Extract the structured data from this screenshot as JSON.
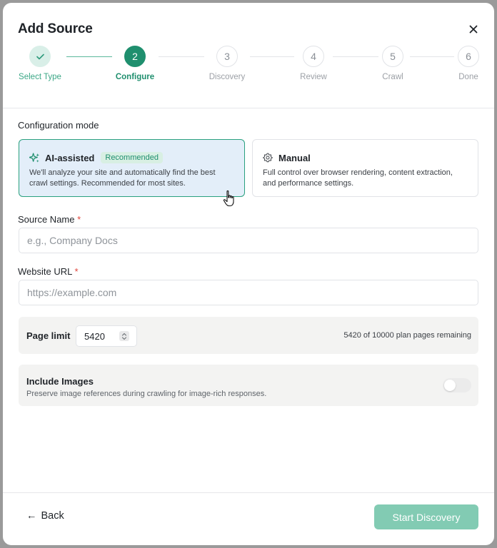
{
  "dialog": {
    "title": "Add Source"
  },
  "steps": [
    {
      "number": "",
      "label": "Select Type",
      "state": "done"
    },
    {
      "number": "2",
      "label": "Configure",
      "state": "active"
    },
    {
      "number": "3",
      "label": "Discovery",
      "state": "pending"
    },
    {
      "number": "4",
      "label": "Review",
      "state": "pending"
    },
    {
      "number": "5",
      "label": "Crawl",
      "state": "pending"
    },
    {
      "number": "6",
      "label": "Done",
      "state": "pending"
    }
  ],
  "config": {
    "label": "Configuration mode",
    "modes": [
      {
        "title": "AI-assisted",
        "badge": "Recommended",
        "description": "We'll analyze your site and automatically find the best crawl settings. Recommended for most sites.",
        "icon": "sparkles-icon",
        "selected": true
      },
      {
        "title": "Manual",
        "description": "Full control over browser rendering, content extraction, and performance settings.",
        "icon": "gear-icon",
        "selected": false
      }
    ]
  },
  "fields": {
    "source_name": {
      "label": "Source Name",
      "required": "*",
      "placeholder": "e.g., Company Docs",
      "value": ""
    },
    "website_url": {
      "label": "Website URL",
      "required": "*",
      "placeholder": "https://example.com",
      "value": ""
    }
  },
  "page_limit": {
    "label": "Page limit",
    "value": "5420",
    "remaining": "5420 of 10000 plan pages remaining"
  },
  "images": {
    "title": "Include Images",
    "description": "Preserve image references during crawling for image-rich responses.",
    "enabled": false
  },
  "footer": {
    "back_label": "Back",
    "back_arrow": "←",
    "primary_label": "Start Discovery"
  },
  "colors": {
    "accent": "#1f8f6e",
    "accent_light": "#d9efe8",
    "selected_card_bg": "#e3eef9",
    "primary_disabled": "#82cbb3",
    "required": "#e0443a"
  }
}
